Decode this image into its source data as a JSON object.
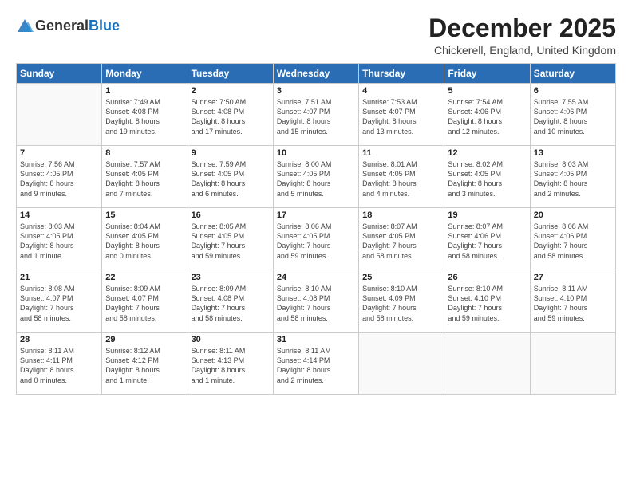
{
  "logo": {
    "general": "General",
    "blue": "Blue"
  },
  "title": "December 2025",
  "location": "Chickerell, England, United Kingdom",
  "weekdays": [
    "Sunday",
    "Monday",
    "Tuesday",
    "Wednesday",
    "Thursday",
    "Friday",
    "Saturday"
  ],
  "weeks": [
    [
      {
        "day": "",
        "info": ""
      },
      {
        "day": "1",
        "info": "Sunrise: 7:49 AM\nSunset: 4:08 PM\nDaylight: 8 hours\nand 19 minutes."
      },
      {
        "day": "2",
        "info": "Sunrise: 7:50 AM\nSunset: 4:08 PM\nDaylight: 8 hours\nand 17 minutes."
      },
      {
        "day": "3",
        "info": "Sunrise: 7:51 AM\nSunset: 4:07 PM\nDaylight: 8 hours\nand 15 minutes."
      },
      {
        "day": "4",
        "info": "Sunrise: 7:53 AM\nSunset: 4:07 PM\nDaylight: 8 hours\nand 13 minutes."
      },
      {
        "day": "5",
        "info": "Sunrise: 7:54 AM\nSunset: 4:06 PM\nDaylight: 8 hours\nand 12 minutes."
      },
      {
        "day": "6",
        "info": "Sunrise: 7:55 AM\nSunset: 4:06 PM\nDaylight: 8 hours\nand 10 minutes."
      }
    ],
    [
      {
        "day": "7",
        "info": "Sunrise: 7:56 AM\nSunset: 4:05 PM\nDaylight: 8 hours\nand 9 minutes."
      },
      {
        "day": "8",
        "info": "Sunrise: 7:57 AM\nSunset: 4:05 PM\nDaylight: 8 hours\nand 7 minutes."
      },
      {
        "day": "9",
        "info": "Sunrise: 7:59 AM\nSunset: 4:05 PM\nDaylight: 8 hours\nand 6 minutes."
      },
      {
        "day": "10",
        "info": "Sunrise: 8:00 AM\nSunset: 4:05 PM\nDaylight: 8 hours\nand 5 minutes."
      },
      {
        "day": "11",
        "info": "Sunrise: 8:01 AM\nSunset: 4:05 PM\nDaylight: 8 hours\nand 4 minutes."
      },
      {
        "day": "12",
        "info": "Sunrise: 8:02 AM\nSunset: 4:05 PM\nDaylight: 8 hours\nand 3 minutes."
      },
      {
        "day": "13",
        "info": "Sunrise: 8:03 AM\nSunset: 4:05 PM\nDaylight: 8 hours\nand 2 minutes."
      }
    ],
    [
      {
        "day": "14",
        "info": "Sunrise: 8:03 AM\nSunset: 4:05 PM\nDaylight: 8 hours\nand 1 minute."
      },
      {
        "day": "15",
        "info": "Sunrise: 8:04 AM\nSunset: 4:05 PM\nDaylight: 8 hours\nand 0 minutes."
      },
      {
        "day": "16",
        "info": "Sunrise: 8:05 AM\nSunset: 4:05 PM\nDaylight: 7 hours\nand 59 minutes."
      },
      {
        "day": "17",
        "info": "Sunrise: 8:06 AM\nSunset: 4:05 PM\nDaylight: 7 hours\nand 59 minutes."
      },
      {
        "day": "18",
        "info": "Sunrise: 8:07 AM\nSunset: 4:05 PM\nDaylight: 7 hours\nand 58 minutes."
      },
      {
        "day": "19",
        "info": "Sunrise: 8:07 AM\nSunset: 4:06 PM\nDaylight: 7 hours\nand 58 minutes."
      },
      {
        "day": "20",
        "info": "Sunrise: 8:08 AM\nSunset: 4:06 PM\nDaylight: 7 hours\nand 58 minutes."
      }
    ],
    [
      {
        "day": "21",
        "info": "Sunrise: 8:08 AM\nSunset: 4:07 PM\nDaylight: 7 hours\nand 58 minutes."
      },
      {
        "day": "22",
        "info": "Sunrise: 8:09 AM\nSunset: 4:07 PM\nDaylight: 7 hours\nand 58 minutes."
      },
      {
        "day": "23",
        "info": "Sunrise: 8:09 AM\nSunset: 4:08 PM\nDaylight: 7 hours\nand 58 minutes."
      },
      {
        "day": "24",
        "info": "Sunrise: 8:10 AM\nSunset: 4:08 PM\nDaylight: 7 hours\nand 58 minutes."
      },
      {
        "day": "25",
        "info": "Sunrise: 8:10 AM\nSunset: 4:09 PM\nDaylight: 7 hours\nand 58 minutes."
      },
      {
        "day": "26",
        "info": "Sunrise: 8:10 AM\nSunset: 4:10 PM\nDaylight: 7 hours\nand 59 minutes."
      },
      {
        "day": "27",
        "info": "Sunrise: 8:11 AM\nSunset: 4:10 PM\nDaylight: 7 hours\nand 59 minutes."
      }
    ],
    [
      {
        "day": "28",
        "info": "Sunrise: 8:11 AM\nSunset: 4:11 PM\nDaylight: 8 hours\nand 0 minutes."
      },
      {
        "day": "29",
        "info": "Sunrise: 8:12 AM\nSunset: 4:12 PM\nDaylight: 8 hours\nand 1 minute."
      },
      {
        "day": "30",
        "info": "Sunrise: 8:11 AM\nSunset: 4:13 PM\nDaylight: 8 hours\nand 1 minute."
      },
      {
        "day": "31",
        "info": "Sunrise: 8:11 AM\nSunset: 4:14 PM\nDaylight: 8 hours\nand 2 minutes."
      },
      {
        "day": "",
        "info": ""
      },
      {
        "day": "",
        "info": ""
      },
      {
        "day": "",
        "info": ""
      }
    ]
  ]
}
